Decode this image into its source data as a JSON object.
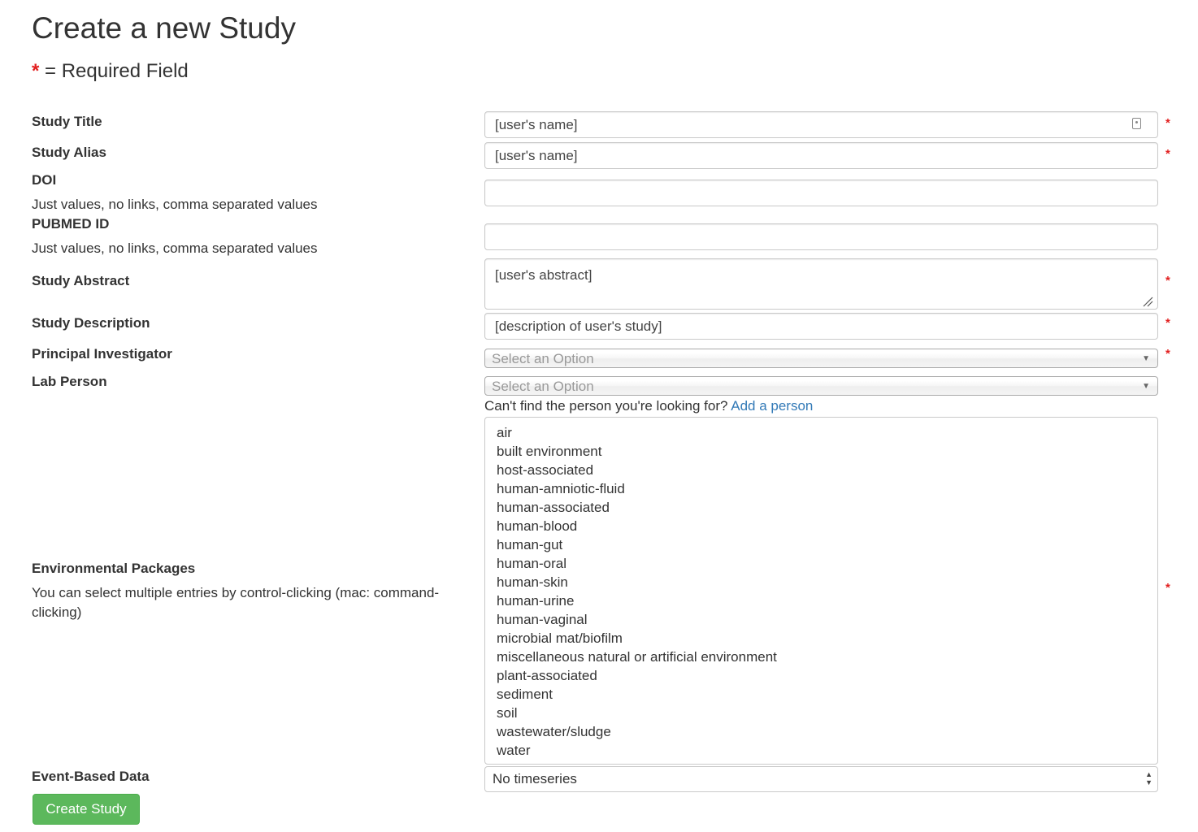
{
  "page": {
    "title": "Create a new Study",
    "required_star": "*",
    "required_note": "= Required Field"
  },
  "form": {
    "study_title": {
      "label": "Study Title",
      "value": "[user's name]",
      "required": "*"
    },
    "study_alias": {
      "label": "Study Alias",
      "value": "[user's name]",
      "required": "*"
    },
    "doi": {
      "label": "DOI",
      "help": "Just values, no links, comma separated values",
      "value": ""
    },
    "pubmed_id": {
      "label": "PUBMED ID",
      "help": "Just values, no links, comma separated values",
      "value": ""
    },
    "study_abstract": {
      "label": "Study Abstract",
      "value": "[user's abstract]",
      "required": "*"
    },
    "study_description": {
      "label": "Study Description",
      "value": "[description of user's study]",
      "required": "*"
    },
    "principal_investigator": {
      "label": "Principal Investigator",
      "placeholder": "Select an Option",
      "required": "*"
    },
    "lab_person": {
      "label": "Lab Person",
      "placeholder": "Select an Option"
    },
    "person_lookup": {
      "text": "Can't find the person you're looking for?",
      "link": "Add a person"
    },
    "environmental_packages": {
      "label": "Environmental Packages",
      "help": "You can select multiple entries by control-clicking (mac: command-clicking)",
      "required": "*",
      "options": [
        "air",
        "built environment",
        "host-associated",
        "human-amniotic-fluid",
        "human-associated",
        "human-blood",
        "human-gut",
        "human-oral",
        "human-skin",
        "human-urine",
        "human-vaginal",
        "microbial mat/biofilm",
        "miscellaneous natural or artificial environment",
        "plant-associated",
        "sediment",
        "soil",
        "wastewater/sludge",
        "water"
      ]
    },
    "event_based_data": {
      "label": "Event-Based Data",
      "value": "No timeseries"
    },
    "submit_label": "Create Study"
  },
  "colors": {
    "required": "#e21f1f",
    "link": "#337ab7",
    "button": "#5cb85c"
  }
}
